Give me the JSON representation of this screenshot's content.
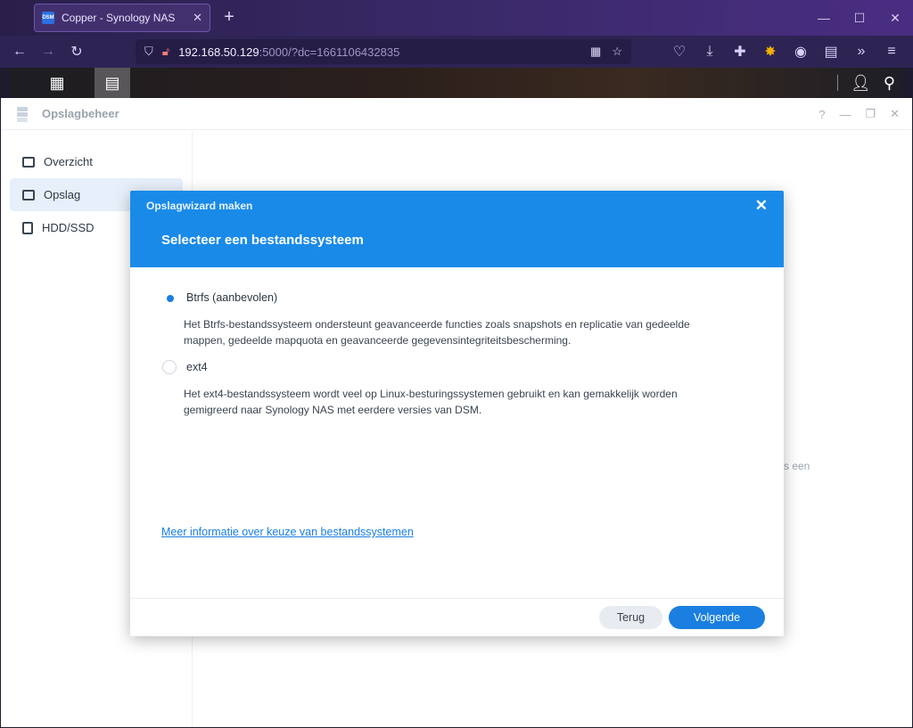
{
  "browser": {
    "tab_title": "Copper - Synology NAS",
    "tab_favicon": "DSM",
    "url_host": "192.168.50.129",
    "url_rest": ":5000/?dc=1661106432835"
  },
  "app": {
    "title": "Opslagbeheer",
    "controls": [
      "?",
      "—",
      "❐",
      "✕"
    ]
  },
  "sidebar": {
    "items": [
      {
        "label": "Overzicht",
        "icon": "overview-icon",
        "active": false
      },
      {
        "label": "Opslag",
        "icon": "storage-icon",
        "active": true
      },
      {
        "label": "HDD/SSD",
        "icon": "hdd-icon",
        "active": false
      }
    ]
  },
  "background_hint": "s een",
  "dialog": {
    "small_title": "Opslagwizard maken",
    "title": "Selecteer een bestandssysteem",
    "options": [
      {
        "label": "Btrfs (aanbevolen)",
        "checked": true,
        "description_line1": "Het Btrfs-bestandssysteem ondersteunt geavanceerde functies zoals snapshots en replicatie van gedeelde",
        "description_line2": "mappen, gedeelde mapquota en geavanceerde gegevensintegriteitsbescherming."
      },
      {
        "label": "ext4",
        "checked": false,
        "description_line1": "Het ext4-bestandssysteem wordt veel op Linux-besturingssystemen gebruikt en kan gemakkelijk worden",
        "description_line2": "gemigreerd naar Synology NAS met eerdere versies van DSM."
      }
    ],
    "info_link": "Meer informatie over keuze van bestandssystemen",
    "back_label": "Terug",
    "next_label": "Volgende"
  },
  "colors": {
    "accent": "#1a7fe0",
    "header": "#1a8ae8"
  }
}
